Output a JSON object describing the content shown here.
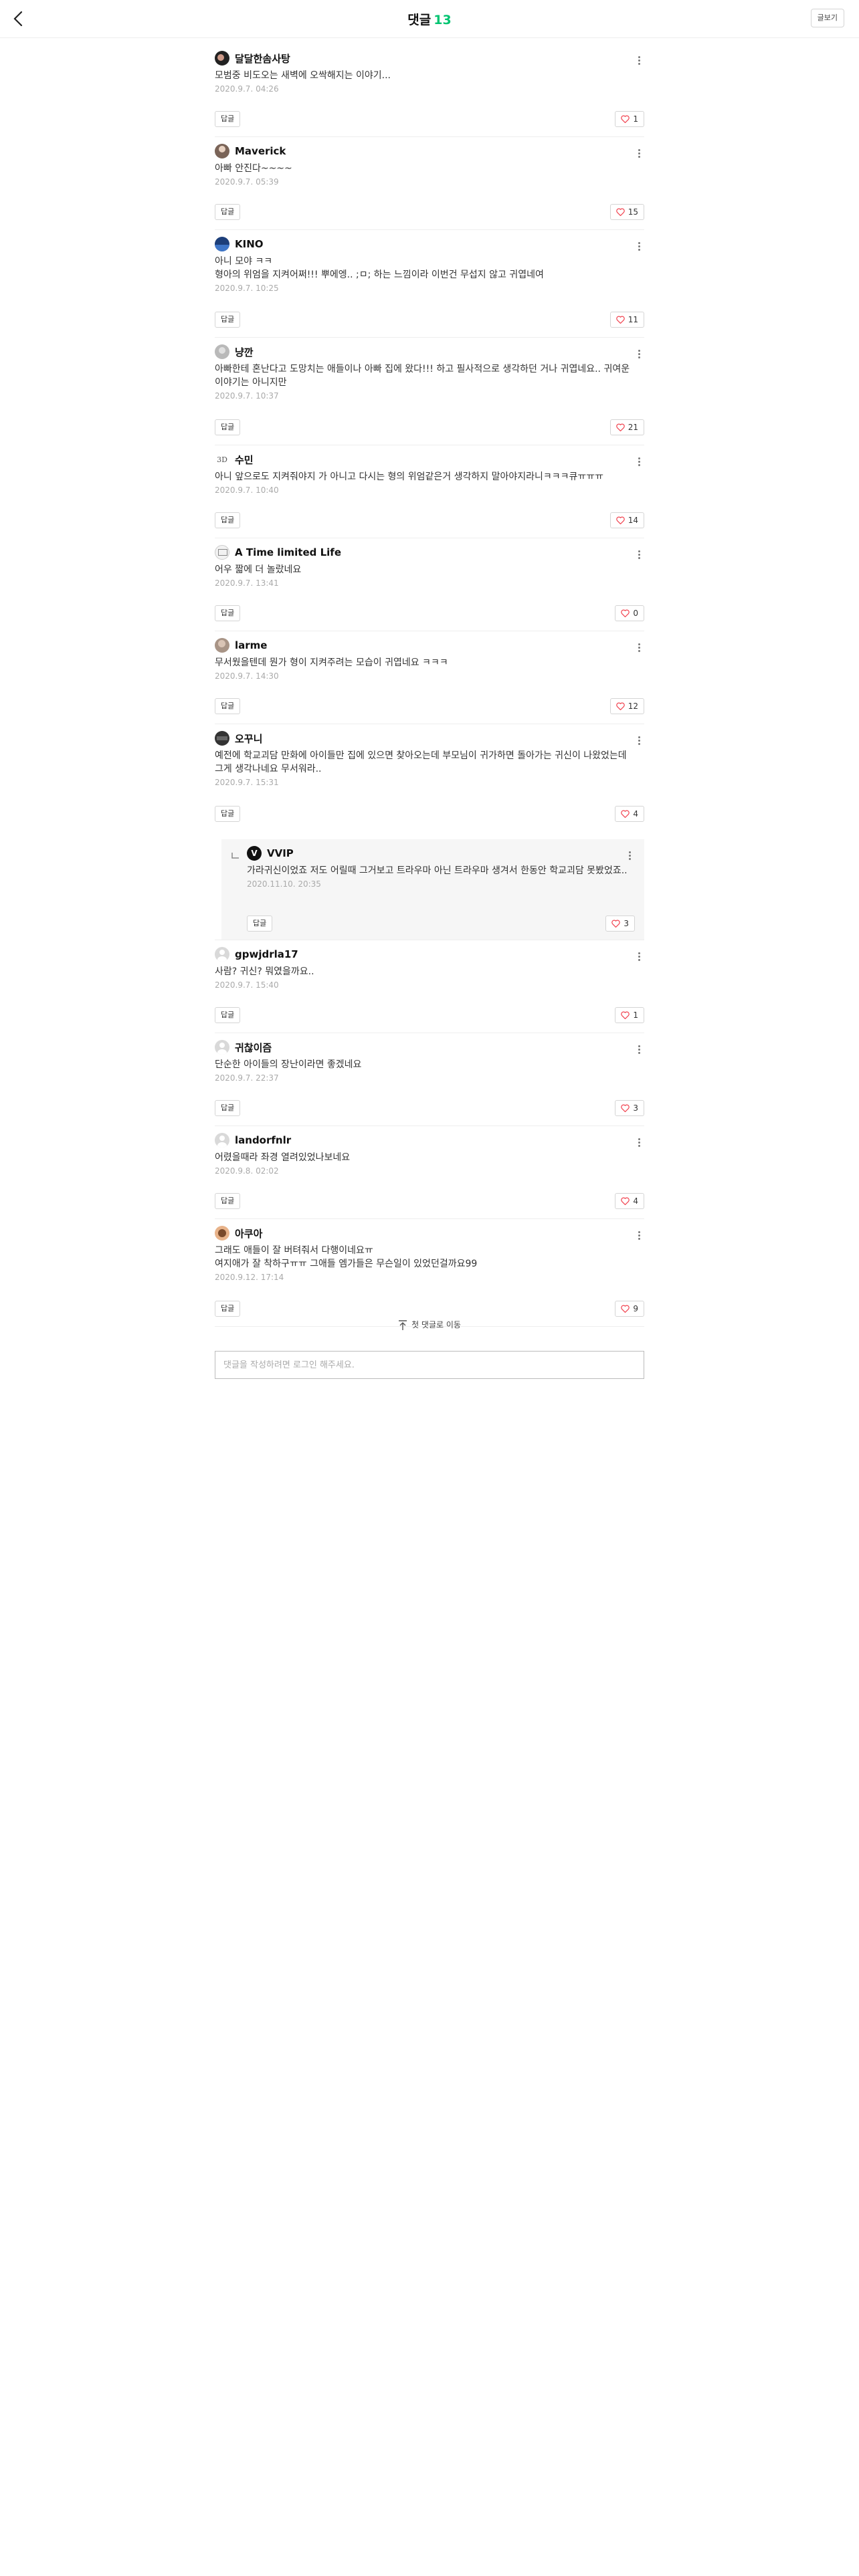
{
  "header": {
    "title": "댓글",
    "count": "13",
    "view_post_label": "글보기"
  },
  "comments": [
    {
      "author": "달달한솜사탕",
      "text": "모범중 비도오는 새벽에 오싹해지는 이야기...",
      "date": "2020.9.7. 04:26",
      "reply_label": "답글",
      "likes": "1",
      "avatar": "dark"
    },
    {
      "author": "Maverick",
      "text": "아빠 안진다~~~~",
      "date": "2020.9.7. 05:39",
      "reply_label": "답글",
      "likes": "15",
      "avatar": "photo"
    },
    {
      "author": "KINO",
      "text": "아니 모야 ㅋㅋ\n형아의 위엄을 지켜어쩌!!! 뿌에엥.. ;ㅁ; 하는 느낌이라 이번건 무섭지 않고 귀엽네여",
      "date": "2020.9.7. 10:25",
      "reply_label": "답글",
      "likes": "11",
      "avatar": "blue"
    },
    {
      "author": "냥깐",
      "text": "아빠한테 혼난다고 도망치는 애들이나 아빠 집에 왔다!!! 하고 필사적으로 생각하던 거나 귀엽네요.. 귀여운 이야기는 아니지만",
      "date": "2020.9.7. 10:37",
      "reply_label": "답글",
      "likes": "21",
      "avatar": "grey"
    },
    {
      "author": "수민",
      "text": "아니 앞으로도 지켜줘야지 가 아니고 다시는 형의 위엄같은거 생각하지 말아야지라니ㅋㅋㅋ큐ㅠㅠㅠ",
      "date": "2020.9.7. 10:40",
      "reply_label": "답글",
      "likes": "14",
      "avatar": "3D"
    },
    {
      "author": "A Time limited Life",
      "text": "어우 짧에 더 놀랐네요",
      "date": "2020.9.7. 13:41",
      "reply_label": "답글",
      "likes": "0",
      "avatar": "sketch"
    },
    {
      "author": "larme",
      "text": "무서웠을텐데 뭔가 형이 지켜주려는 모습이 귀엽네요 ㅋㅋㅋ",
      "date": "2020.9.7. 14:30",
      "reply_label": "답글",
      "likes": "12",
      "avatar": "photo2"
    },
    {
      "author": "오꾸니",
      "text": "예전에 학교괴담 만화에 아이들만 집에 있으면 찾아오는데 부모님이 귀가하면 돌아가는 귀신이 나왔었는데 그게 생각나네요 무서워라..",
      "date": "2020.9.7. 15:31",
      "reply_label": "답글",
      "likes": "4",
      "avatar": "dark2"
    }
  ],
  "reply": {
    "author": "VVIP",
    "text": "가라귀신이었죠 저도 어릴때 그거보고 트라우마 아닌 트라우마 생겨서 한동안 학교괴담 못봤었죠..",
    "date": "2020.11.10. 20:35",
    "reply_label": "답글",
    "likes": "3",
    "badge": "V"
  },
  "comments2": [
    {
      "author": "gpwjdrla17",
      "text": "사람? 귀신? 뭐였을까요..",
      "date": "2020.9.7. 15:40",
      "reply_label": "답글",
      "likes": "1"
    },
    {
      "author": "귀찮이즘",
      "text": "단순한 아이들의 장난이라면 좋겠네요",
      "date": "2020.9.7. 22:37",
      "reply_label": "답글",
      "likes": "3"
    },
    {
      "author": "landorfnlr",
      "text": "어렸을때라 좌경 열려있었나보네요",
      "date": "2020.9.8. 02:02",
      "reply_label": "답글",
      "likes": "4"
    },
    {
      "author": "아쿠아",
      "text": "그래도 애들이 잘 버텨줘서 다행이네요ㅠ\n여지애가 잘 착하구ㅠㅠ 그애들 엠가들은 무슨일이 있었던걸까요99",
      "date": "2020.9.12. 17:14",
      "reply_label": "답글",
      "likes": "9"
    }
  ],
  "footer": {
    "first_comment_label": "첫 댓글로 이동",
    "input_placeholder": "댓글을 작성하려면 로그인 해주세요."
  },
  "colors": {
    "accent": "#00c471",
    "like_heart": "#f1414e"
  }
}
